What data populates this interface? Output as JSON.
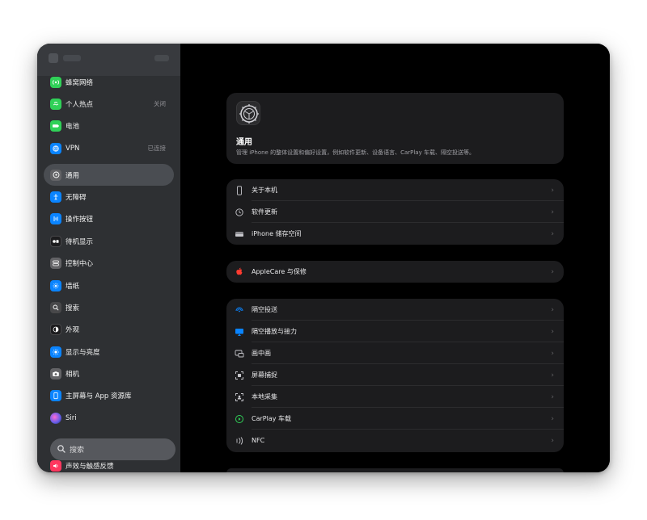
{
  "sidebar": {
    "items": [
      {
        "label": "蜂窝网络",
        "value": "",
        "icon": "cellular-icon",
        "color": "#30d158"
      },
      {
        "label": "个人热点",
        "value": "关闭",
        "icon": "hotspot-icon",
        "color": "#30d158"
      },
      {
        "label": "电池",
        "value": "",
        "icon": "battery-icon",
        "color": "#30d158"
      },
      {
        "label": "VPN",
        "value": "已连接",
        "icon": "vpn-icon",
        "color": "#0a84ff"
      },
      {
        "label": "通用",
        "value": "",
        "icon": "gear-icon",
        "color": "#8e8e93",
        "selected": true
      },
      {
        "label": "无障碍",
        "value": "",
        "icon": "accessibility-icon",
        "color": "#0a84ff"
      },
      {
        "label": "操作按钮",
        "value": "",
        "icon": "action-button-icon",
        "color": "#0a84ff"
      },
      {
        "label": "待机显示",
        "value": "",
        "icon": "standby-icon",
        "color": "#1c1c1e"
      },
      {
        "label": "控制中心",
        "value": "",
        "icon": "control-center-icon",
        "color": "#8e8e93"
      },
      {
        "label": "墙纸",
        "value": "",
        "icon": "wallpaper-icon",
        "color": "#0a84ff"
      },
      {
        "label": "搜索",
        "value": "",
        "icon": "search-icon",
        "color": "#636366"
      },
      {
        "label": "外观",
        "value": "",
        "icon": "appearance-icon",
        "color": "#1c1c1e"
      },
      {
        "label": "显示与亮度",
        "value": "",
        "icon": "brightness-icon",
        "color": "#0a84ff"
      },
      {
        "label": "相机",
        "value": "",
        "icon": "camera-icon",
        "color": "#8e8e93"
      },
      {
        "label": "主屏幕与 App 资源库",
        "value": "",
        "icon": "home-screen-icon",
        "color": "#0a84ff"
      },
      {
        "label": "Siri",
        "value": "",
        "icon": "siri-icon",
        "color": "#5e5ce6"
      }
    ],
    "search_placeholder": "搜索",
    "bottom_item": {
      "label": "声效与触感反馈",
      "icon": "sound-icon",
      "color": "#ff375f"
    }
  },
  "hero": {
    "title": "通用",
    "description": "管理 iPhone 的整体设置和偏好设置，例如软件更新、设备语言、CarPlay 车载、隔空投送等。"
  },
  "groups": [
    {
      "rows": [
        {
          "label": "关于本机",
          "icon": "phone-icon",
          "color": "#8e8e93"
        },
        {
          "label": "软件更新",
          "icon": "software-update-icon",
          "color": "#8e8e93"
        },
        {
          "label": "iPhone 储存空间",
          "icon": "storage-icon",
          "color": "#8e8e93"
        }
      ]
    },
    {
      "rows": [
        {
          "label": "AppleCare 与保修",
          "icon": "apple-icon",
          "color": "#ff3b30"
        }
      ]
    },
    {
      "rows": [
        {
          "label": "隔空投送",
          "icon": "airdrop-icon",
          "color": "#0a84ff"
        },
        {
          "label": "隔空播放与接力",
          "icon": "airplay-icon",
          "color": "#0a84ff"
        },
        {
          "label": "画中画",
          "icon": "pip-icon",
          "color": "#8e8e93"
        },
        {
          "label": "屏幕捕捉",
          "icon": "screen-capture-icon",
          "color": "#8e8e93"
        },
        {
          "label": "本地采集",
          "icon": "local-capture-icon",
          "color": "#8e8e93"
        },
        {
          "label": "CarPlay 车载",
          "icon": "carplay-icon",
          "color": "#30d158"
        },
        {
          "label": "NFC",
          "icon": "nfc-icon",
          "color": "#8e8e93"
        }
      ]
    }
  ],
  "chevron": "›"
}
